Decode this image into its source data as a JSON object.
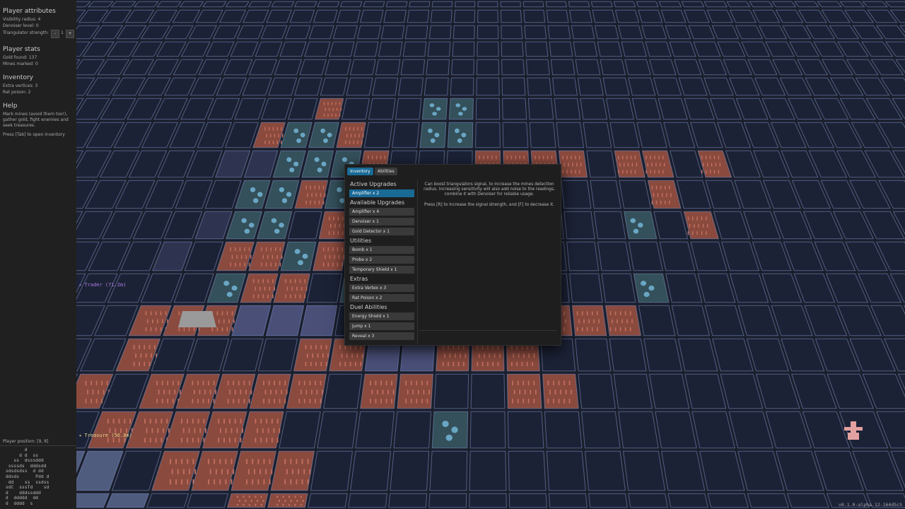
{
  "sidebar": {
    "attributes": {
      "heading": "Player attributes",
      "visibility": "Visibility radius: 4",
      "denoiser": "Denoiser level: 0",
      "triangulator_label": "Triangulator strength:",
      "triangulator_minus": "-",
      "triangulator_value": "1",
      "triangulator_plus": "+"
    },
    "stats": {
      "heading": "Player stats",
      "gold": "Gold found: 137",
      "mines": "Mines marked: 0"
    },
    "inventory": {
      "heading": "Inventory",
      "vertices": "Extra vertices: 3",
      "rat_poison": "Rat poison: 2"
    },
    "help": {
      "heading": "Help",
      "line1": "Mark mines (avoid them too!),",
      "line2": "gather gold, fight enemies and",
      "line3": "seek treasures.",
      "tab_hint": "Press [Tab] to open inventory"
    },
    "position": "Player position: [9, 8]",
    "ascii_map": "        d\n      d d  ss\n    ss  dsssddd\n  ssssds  dddsdd\n sdsdsdss  d dd\n ddsds      Pdd d\n  dd    ss  ssdss\n sdC  sssTd    sd\n d    dddssddd\n d  ddddd  dd\n d  dddd  s"
  },
  "markers": {
    "trader": "◂ Trader (71.2m)",
    "treasure": "◂ Treasure (56.8m)"
  },
  "dialog": {
    "tabs": [
      "Inventory",
      "Abilities"
    ],
    "sections": {
      "active": "Active Upgrades",
      "available": "Available Upgrades",
      "utilities": "Utilities",
      "extras": "Extras",
      "duel": "Duel Abilities"
    },
    "items": {
      "active": [
        "Amplifier x 2"
      ],
      "available": [
        "Amplifier x 4",
        "Denoiser x 1",
        "Gold Detector x 1"
      ],
      "utilities": [
        "Bomb x 1",
        "Probe x 2",
        "Temporary Shield x 1"
      ],
      "extras": [
        "Extra Vertex x 3",
        "Rat Poison x 2"
      ],
      "duel": [
        "Energy Shield x 1",
        "Jump x 1",
        "Reveal x 3"
      ]
    },
    "description": {
      "line1": "Can boost triangulators signal, to increase the mines detection",
      "line2": "radius. Increasing sensitivity will also add noise to the readings,",
      "line3": "combine it with Denoiser for reliable usage.",
      "line4": "Press [R] to increase the signal strength, and [F] to decrease it."
    }
  },
  "version": "v0.1.0-alpha.12-164d5c5",
  "colors": {
    "accent": "#1a6a96",
    "empty_tile": "#1c2236",
    "grid_line": "#7d93cc",
    "mine_tile": "#8a4a3e",
    "water_tile": "#34505a",
    "stone_tile": "#505c7e",
    "trader_marker": "#b07ae0",
    "treasure_marker": "#e6d28a",
    "npc": "#e3a0a0"
  }
}
